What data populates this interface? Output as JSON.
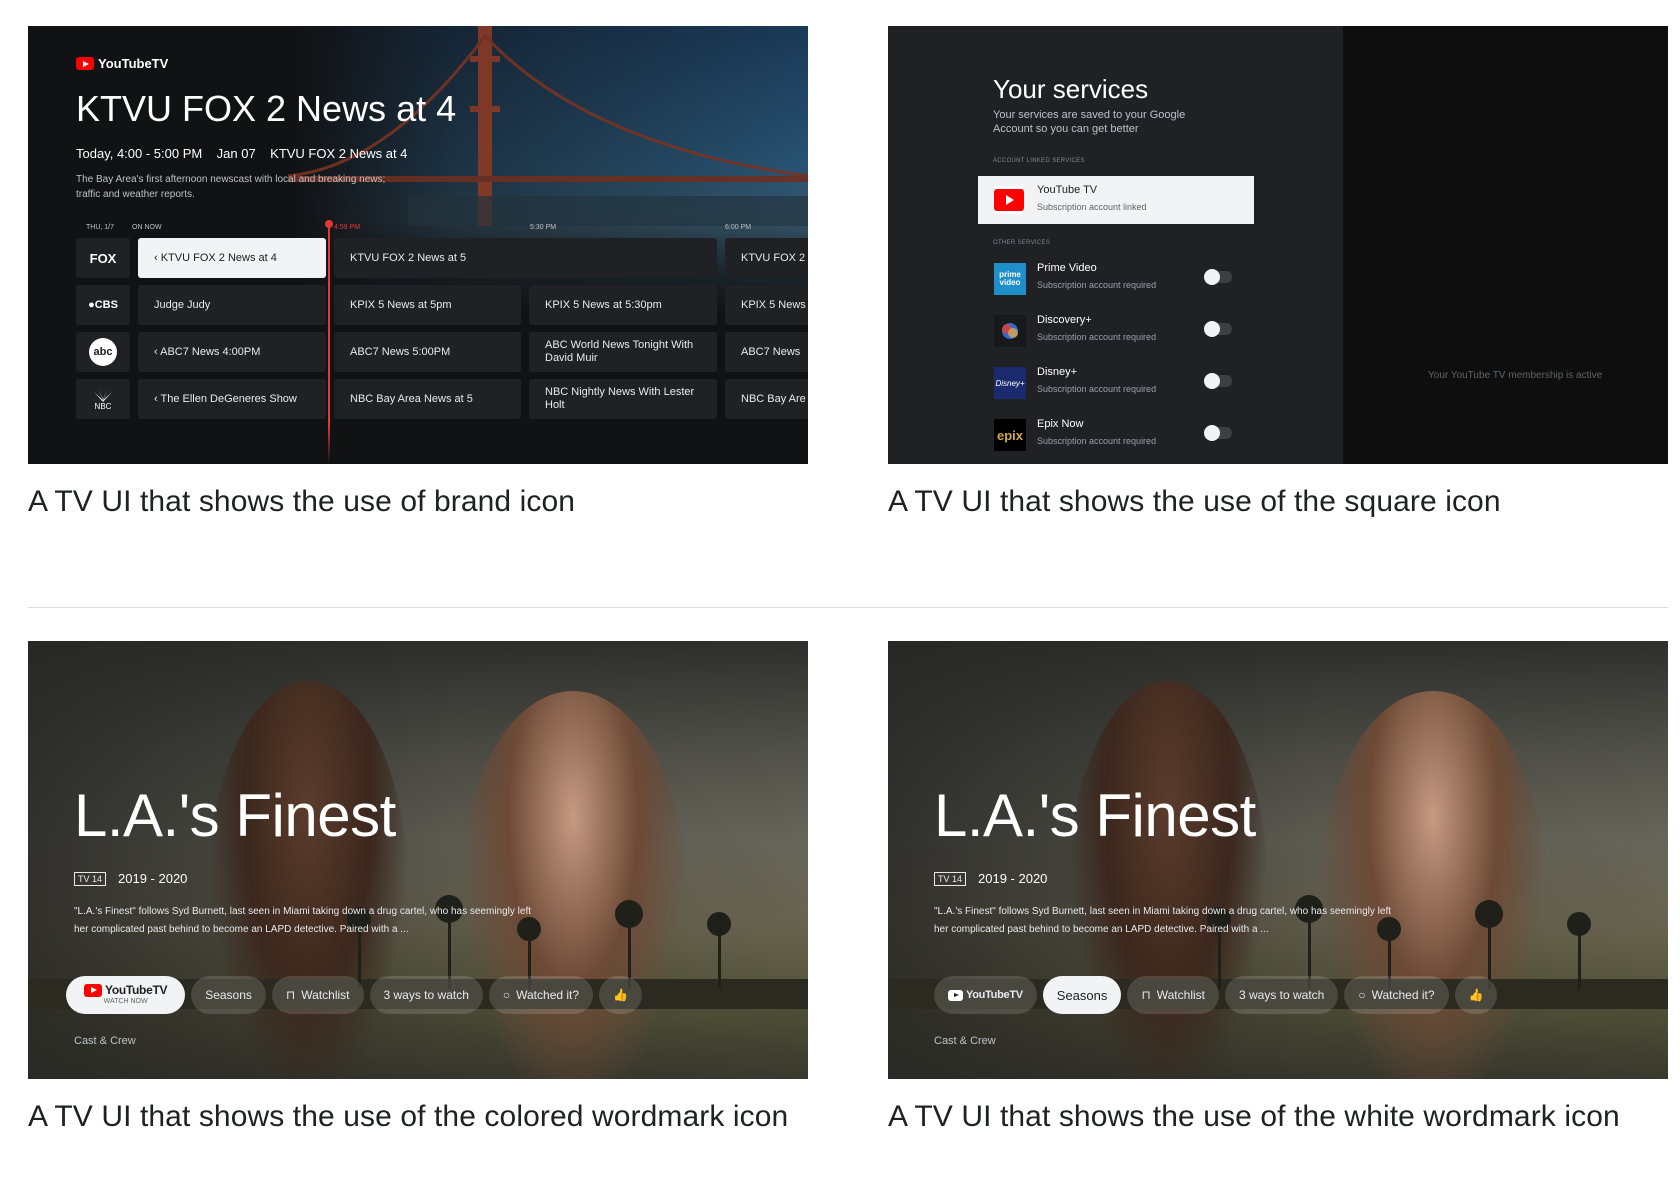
{
  "captions": {
    "brand": "A TV UI that shows the use of brand icon",
    "square": "A TV UI that shows the use of the square icon",
    "colored": "A TV UI that shows the use of the colored wordmark icon",
    "white": "A TV UI that shows the use of the white wordmark icon"
  },
  "guide": {
    "brand": "YouTubeTV",
    "title": "KTVU FOX 2 News at 4",
    "meta": "Today, 4:00 - 5:00 PM    Jan 07    KTVU FOX 2 News at 4",
    "description": "The Bay Area's first afternoon newscast with local and breaking news; traffic and weather reports.",
    "times": [
      "THU, 1/7",
      "ON NOW",
      "5:30 PM",
      "6:00 PM"
    ],
    "now_time": "4:59 PM",
    "channels": [
      {
        "logo": "FOX",
        "programs": [
          "‹  KTVU FOX 2 News at 4",
          "KTVU FOX 2 News at 5",
          "KTVU FOX 2"
        ]
      },
      {
        "logo": "●CBS",
        "programs": [
          "Judge Judy",
          "KPIX 5 News at 5pm",
          "KPIX 5 News at 5:30pm",
          "KPIX 5 News"
        ]
      },
      {
        "logo": "abc",
        "programs": [
          "‹  ABC7 News 4:00PM",
          "ABC7 News 5:00PM",
          "ABC World News Tonight With David Muir",
          "ABC7 News"
        ]
      },
      {
        "logo": "NBC",
        "programs": [
          "‹  The Ellen DeGeneres Show",
          "NBC Bay Area News at 5",
          "NBC Nightly News With Lester Holt",
          "NBC Bay Are"
        ]
      }
    ]
  },
  "services": {
    "title": "Your services",
    "subtitle": "Your services are saved to your Google Account so you can get better",
    "linked_header": "Account linked services",
    "other_header": "Other services",
    "linked": {
      "name": "YouTube TV",
      "status": "Subscription account linked"
    },
    "others": [
      {
        "name": "Prime Video",
        "status": "Subscription account required",
        "icon": "prime video"
      },
      {
        "name": "Discovery+",
        "status": "Subscription account required",
        "icon": "discovery-icon"
      },
      {
        "name": "Disney+",
        "status": "Subscription account required",
        "icon": "Disney+"
      },
      {
        "name": "Epix Now",
        "status": "Subscription account required",
        "icon": "epix"
      }
    ],
    "membership": "Your YouTube TV membership is active"
  },
  "details": {
    "title": "L.A.'s Finest",
    "rating": "TV 14",
    "years": "2019 - 2020",
    "synopsis": "\"L.A.'s Finest\" follows Syd Burnett, last seen in Miami taking down a drug cartel, who has seemingly left her complicated past behind to become an LAPD detective. Paired with a ...",
    "wordmark": "YouTubeTV",
    "watch_now": "WATCH NOW",
    "seasons": "Seasons",
    "watchlist": "Watchlist",
    "ways": "3 ways to watch",
    "watched": "Watched it?",
    "cast": "Cast & Crew"
  },
  "colors": {
    "youtube_red": "#ff0000",
    "now_line": "#e53935"
  }
}
